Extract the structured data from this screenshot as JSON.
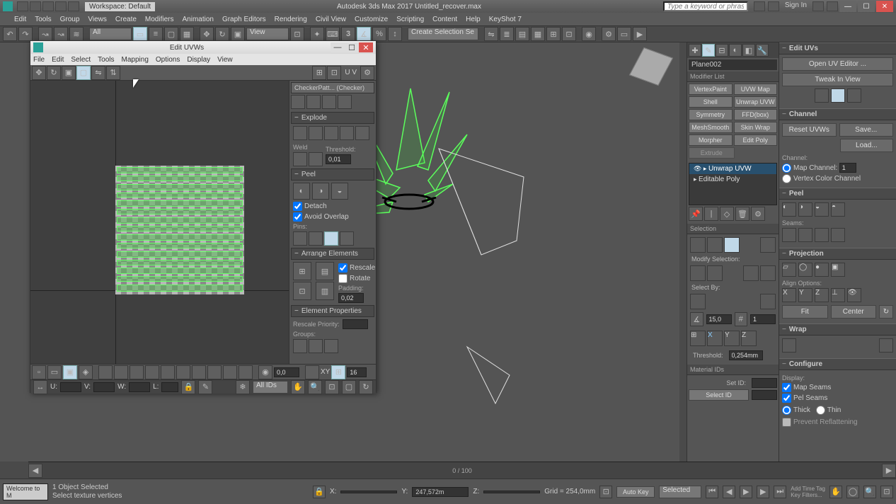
{
  "app": {
    "title": "Autodesk 3ds Max 2017     Untitled_recover.max",
    "workspace_label": "Workspace: Default",
    "search_placeholder": "Type a keyword or phrase",
    "sign_in": "Sign In"
  },
  "main_menu": [
    "Edit",
    "Tools",
    "Group",
    "Views",
    "Create",
    "Modifiers",
    "Animation",
    "Graph Editors",
    "Rendering",
    "Civil View",
    "Customize",
    "Scripting",
    "Content",
    "Help",
    "KeyShot 7"
  ],
  "toolbar": {
    "combo1": "All",
    "view_dd": "View",
    "create_sel_dd": "Create Selection Se"
  },
  "uvw": {
    "title": "Edit UVWs",
    "menu": [
      "File",
      "Edit",
      "Select",
      "Tools",
      "Mapping",
      "Options",
      "Display",
      "View"
    ],
    "checker_dd": "CheckerPatt... (Checker)",
    "explode_hdr": "Explode",
    "weld_lbl": "Weld",
    "threshold_lbl": "Threshold:",
    "threshold_val": "0,01",
    "peel_hdr": "Peel",
    "detach_lbl": "Detach",
    "avoid_overlap_lbl": "Avoid Overlap",
    "pins_lbl": "Pins:",
    "arrange_hdr": "Arrange Elements",
    "rescale_lbl": "Rescale",
    "rotate_lbl": "Rotate",
    "padding_lbl": "Padding:",
    "padding_val": "0,02",
    "elemprop_hdr": "Element Properties",
    "rescale_prio_lbl": "Rescale Priority:",
    "groups_lbl": "Groups:",
    "uv_toggle": "U V",
    "status_U": "U:",
    "status_V": "V:",
    "status_W": "W:",
    "status_L": "L:",
    "status_XY": "XY",
    "status_num1": "0,0",
    "status_num2": "16",
    "ids_dd": "All IDs"
  },
  "cmd": {
    "obj_name": "Plane002",
    "modlist_lbl": "Modifier List",
    "mods": [
      [
        "VertexPaint",
        "UVW Map"
      ],
      [
        "Shell",
        "Unwrap UVW"
      ],
      [
        "Symmetry",
        "FFD(box)"
      ],
      [
        "MeshSmooth",
        "Skin Wrap"
      ],
      [
        "Morpher",
        "Edit Poly"
      ],
      [
        "Extrude",
        ""
      ]
    ],
    "stack": [
      "Unwrap UVW",
      "Editable Poly"
    ],
    "sel_hdr": "Selection",
    "modsel_lbl": "Modify Selection:",
    "selectby_lbl": "Select By:",
    "selby_val": "15,0",
    "selby_count": "1",
    "threshold_lbl": "Threshold:",
    "threshold_val": "0,254mm",
    "matid_hdr": "Material IDs",
    "setid_lbl": "Set ID:",
    "selid_lbl": "Select ID"
  },
  "edit": {
    "hdr_edituvs": "Edit UVs",
    "open_editor": "Open UV Editor ...",
    "tweak": "Tweak In View",
    "hdr_channel": "Channel",
    "resetuvw": "Reset UVWs",
    "save": "Save...",
    "load": "Load...",
    "channel_lbl": "Channel:",
    "mapchan": "Map Channel:",
    "mapchan_val": "1",
    "vertexcol": "Vertex Color Channel",
    "hdr_peel": "Peel",
    "seams_lbl": "Seams:",
    "hdr_projection": "Projection",
    "align_lbl": "Align Options:",
    "align_X": "X",
    "align_Y": "Y",
    "align_Z": "Z",
    "fit_btn": "Fit",
    "center_btn": "Center",
    "hdr_wrap": "Wrap",
    "hdr_configure": "Configure",
    "display_lbl": "Display:",
    "mapseams": "Map Seams",
    "pelseams": "Pel Seams",
    "thick": "Thick",
    "thin": "Thin",
    "prevent_lbl": "Prevent Reflattening"
  },
  "timeline": {
    "frame_text": "0 / 100"
  },
  "status": {
    "welcome": "Welcome to M",
    "sel_count": "1 Object Selected",
    "prompt": "Select texture vertices",
    "X": "X:",
    "Y": "Y:",
    "Z": "Z:",
    "grid": "Grid = 254,0mm",
    "autokey": "Auto Key",
    "selected_dd": "Selected",
    "addtimetag": "Add Time Tag",
    "keyfilters": "Key Filters...",
    "coord_y": "247,572m"
  }
}
